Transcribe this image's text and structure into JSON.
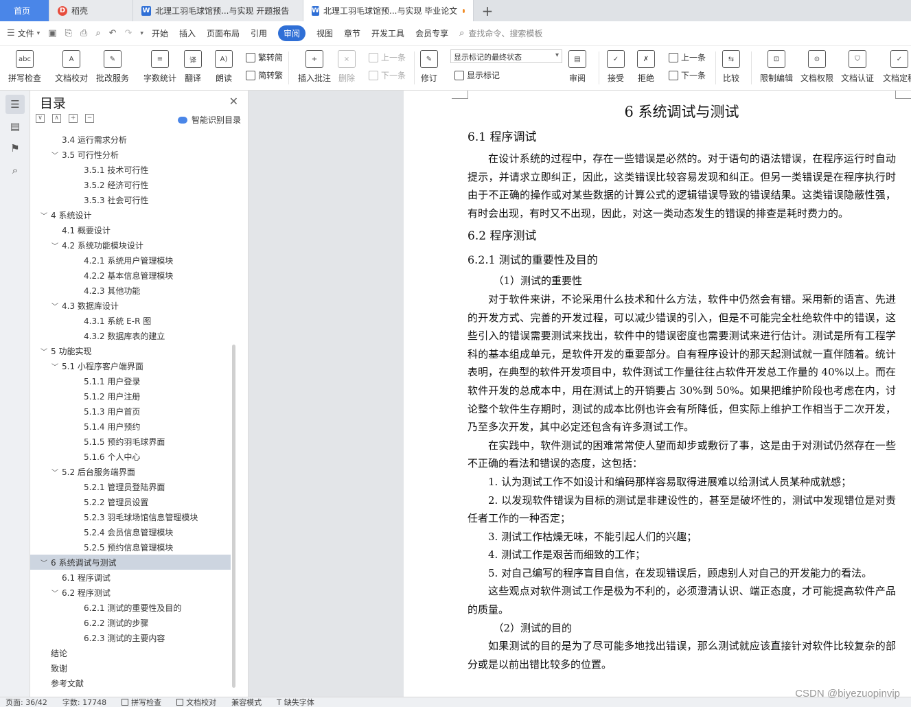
{
  "tabs": {
    "home": "首页",
    "wps": "稻壳",
    "doc1": "北理工羽毛球馆预...与实现 开题报告",
    "doc2": "北理工羽毛球馆预...与实现 毕业论文",
    "add": "+"
  },
  "menubar": {
    "file": "文件",
    "items": [
      "开始",
      "插入",
      "页面布局",
      "引用",
      "审阅",
      "视图",
      "章节",
      "开发工具",
      "会员专享"
    ],
    "search_placeholder": "查找命令、搜索模板"
  },
  "ribbon": {
    "spell_check": "拼写检查",
    "doc_proof": "文档校对",
    "batch_service": "批改服务",
    "word_count": "字数统计",
    "translate": "翻译",
    "read_aloud": "朗读",
    "to_traditional": "繁转简",
    "to_simplified": "简转繁",
    "insert_comment": "插入批注",
    "delete": "删除",
    "prev": "上一条",
    "next": "下一条",
    "track": "修订",
    "markup_state": "显示标记的最终状态",
    "show_markup": "显示标记",
    "review": "审阅",
    "accept": "接受",
    "reject": "拒绝",
    "prev2": "上一条",
    "next2": "下一条",
    "compare": "比较",
    "restrict": "限制编辑",
    "permission": "文档权限",
    "auth": "文档认证",
    "finalize": "文档定稿"
  },
  "toc": {
    "title": "目录",
    "smart": "智能识别目录",
    "items": [
      {
        "label": "3.4  运行需求分析",
        "level": 2,
        "arrow": ""
      },
      {
        "label": "3.5  可行性分析",
        "level": 2,
        "arrow": "﹀"
      },
      {
        "label": "3.5.1 技术可行性",
        "level": 3,
        "arrow": ""
      },
      {
        "label": "3.5.2 经济可行性",
        "level": 3,
        "arrow": ""
      },
      {
        "label": "3.5.3 社会可行性",
        "level": 3,
        "arrow": ""
      },
      {
        "label": "4  系统设计",
        "level": 1,
        "arrow": "﹀"
      },
      {
        "label": "4.1  概要设计",
        "level": 2,
        "arrow": ""
      },
      {
        "label": "4.2  系统功能模块设计",
        "level": 2,
        "arrow": "﹀"
      },
      {
        "label": "4.2.1  系统用户管理模块",
        "level": 3,
        "arrow": ""
      },
      {
        "label": "4.2.2  基本信息管理模块",
        "level": 3,
        "arrow": ""
      },
      {
        "label": "4.2.3  其他功能",
        "level": 3,
        "arrow": ""
      },
      {
        "label": "4.3  数据库设计",
        "level": 2,
        "arrow": "﹀"
      },
      {
        "label": "4.3.1  系统 E-R 图",
        "level": 3,
        "arrow": ""
      },
      {
        "label": "4.3.2  数据库表的建立",
        "level": 3,
        "arrow": ""
      },
      {
        "label": "5  功能实现",
        "level": 1,
        "arrow": "﹀"
      },
      {
        "label": "5.1  小程序客户端界面",
        "level": 2,
        "arrow": "﹀"
      },
      {
        "label": "5.1.1 用户登录",
        "level": 3,
        "arrow": ""
      },
      {
        "label": "5.1.2  用户注册",
        "level": 3,
        "arrow": ""
      },
      {
        "label": "5.1.3  用户首页",
        "level": 3,
        "arrow": ""
      },
      {
        "label": "5.1.4  用户预约",
        "level": 3,
        "arrow": ""
      },
      {
        "label": "5.1.5  预约羽毛球界面",
        "level": 3,
        "arrow": ""
      },
      {
        "label": "5.1.6  个人中心",
        "level": 3,
        "arrow": ""
      },
      {
        "label": "5.2  后台服务端界面",
        "level": 2,
        "arrow": "﹀"
      },
      {
        "label": "5.2.1  管理员登陆界面",
        "level": 3,
        "arrow": ""
      },
      {
        "label": "5.2.2  管理员设置",
        "level": 3,
        "arrow": ""
      },
      {
        "label": "5.2.3  羽毛球场馆信息管理模块",
        "level": 3,
        "arrow": ""
      },
      {
        "label": "5.2.4  会员信息管理模块",
        "level": 3,
        "arrow": ""
      },
      {
        "label": "5.2.5  预约信息管理模块",
        "level": 3,
        "arrow": ""
      },
      {
        "label": "6  系统调试与测试",
        "level": 1,
        "arrow": "﹀",
        "active": true
      },
      {
        "label": "6.1  程序调试",
        "level": 2,
        "arrow": ""
      },
      {
        "label": "6.2  程序测试",
        "level": 2,
        "arrow": "﹀"
      },
      {
        "label": "6.2.1  测试的重要性及目的",
        "level": 3,
        "arrow": ""
      },
      {
        "label": "6.2.2  测试的步骤",
        "level": 3,
        "arrow": ""
      },
      {
        "label": "6.2.3  测试的主要内容",
        "level": 3,
        "arrow": ""
      },
      {
        "label": "结论",
        "level": 1,
        "arrow": ""
      },
      {
        "label": "致谢",
        "level": 1,
        "arrow": ""
      },
      {
        "label": "参考文献",
        "level": 1,
        "arrow": ""
      }
    ]
  },
  "doc": {
    "h1": "6  系统调试与测试",
    "h2_1": "6.1  程序调试",
    "p1": "在设计系统的过程中，存在一些错误是必然的。对于语句的语法错误，在程序运行时自动提示，并请求立即纠正，因此，这类错误比较容易发现和纠正。但另一类错误是在程序执行时由于不正确的操作或对某些数据的计算公式的逻辑错误导致的错误结果。这类错误隐蔽性强，有时会出现，有时又不出现，因此，对这一类动态发生的错误的排查是耗时费力的。",
    "h2_2": "6.2  程序测试",
    "h3_1": "6.2.1  测试的重要性及目的",
    "sub1": "（1）测试的重要性",
    "p2": "对于软件来讲，不论采用什么技术和什么方法，软件中仍然会有错。采用新的语言、先进的开发方式、完善的开发过程，可以减少错误的引入，但是不可能完全杜绝软件中的错误，这些引入的错误需要测试来找出，软件中的错误密度也需要测试来进行估计。测试是所有工程学科的基本组成单元，是软件开发的重要部分。自有程序设计的那天起测试就一直伴随着。统计表明，在典型的软件开发项目中，软件测试工作量往往占软件开发总工作量的 40%以上。而在软件开发的总成本中，用在测试上的开销要占 30%到 50%。如果把维护阶段也考虑在内，讨论整个软件生存期时，测试的成本比例也许会有所降低，但实际上维护工作相当于二次开发，乃至多次开发，其中必定还包含有许多测试工作。",
    "p3": "在实践中，软件测试的困难常常使人望而却步或敷衍了事，这是由于对测试仍然存在一些不正确的看法和错误的态度，这包括：",
    "li1": "1. 认为测试工作不如设计和编码那样容易取得进展难以给测试人员某种成就感；",
    "li2": "2. 以发现软件错误为目标的测试是非建设性的，甚至是破坏性的，测试中发现错位是对责任者工作的一种否定；",
    "li3": "3. 测试工作枯燥无味，不能引起人们的兴趣；",
    "li4": "4. 测试工作是艰苦而细致的工作；",
    "li5": "5. 对自己编写的程序盲目自信，在发现错误后，顾虑别人对自己的开发能力的看法。",
    "p4": "这些观点对软件测试工作是极为不利的，必须澄清认识、端正态度，才可能提高软件产品的质量。",
    "sub2": "（2）测试的目的",
    "p5": "如果测试的目的是为了尽可能多地找出错误，那么测试就应该直接针对软件比较复杂的部分或是以前出错比较多的位置。"
  },
  "status": {
    "page": "页面: 36/42",
    "words": "字数: 17748",
    "spell": "拼写检查",
    "proof": "文档校对",
    "compat": "兼容模式",
    "missing_font": "缺失字体"
  },
  "watermark": "CSDN @biyezuopinvip"
}
